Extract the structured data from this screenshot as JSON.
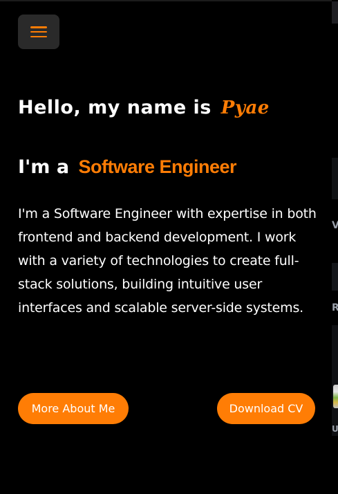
{
  "header": {
    "menu_icon": "hamburger-icon",
    "menu_icon_color": "#ff7d05"
  },
  "hero": {
    "greeting_prefix": "Hello, my name is",
    "name": "Pyae",
    "role_prefix": "I'm a",
    "role": "Software Engineer",
    "bio": "I'm a Software Engineer with expertise in both frontend and backend development. I work with a variety of technologies to create full-stack solutions, building intuitive user interfaces and scalable server-side systems.",
    "buttons": {
      "about_label": "More About Me",
      "cv_label": "Download CV"
    }
  },
  "edge_strip": {
    "glyph_1": "V",
    "glyph_2": "R",
    "glyph_3": "U"
  },
  "colors": {
    "accent": "#ff7d05",
    "background": "#000000",
    "text": "#ffffff",
    "menu_bg": "#2a2a2a"
  }
}
